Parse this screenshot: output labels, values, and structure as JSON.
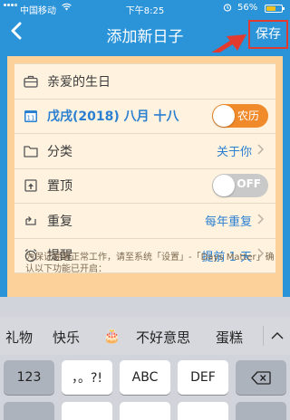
{
  "status_bar": {
    "carrier": "中国移动",
    "time": "下午8:25",
    "battery_pct": "56%",
    "icons": [
      "signal-icon",
      "wifi-icon",
      "alarm-icon",
      "battery-icon"
    ]
  },
  "nav": {
    "back_icon": "chevron-left-icon",
    "title": "添加新日子",
    "save_label": "保存"
  },
  "form": {
    "rows": [
      {
        "icon": "briefcase-icon",
        "label": "亲爱的生日"
      },
      {
        "icon": "calendar-icon",
        "calendar_day": "11",
        "label": "戊戌(2018) 八月 十八",
        "toggle_label": "农历",
        "toggle_on": true
      },
      {
        "icon": "folder-icon",
        "label": "分类",
        "value": "关于你"
      },
      {
        "icon": "pin-top-icon",
        "label": "置顶",
        "toggle_label": "OFF",
        "toggle_on": false
      },
      {
        "icon": "repeat-icon",
        "label": "重复",
        "value": "每年重复"
      },
      {
        "icon": "alarm-clock-icon",
        "label": "提醒",
        "value": "提前 1 天"
      }
    ],
    "note": "为保证提醒正常工作，请至系统「设置」-「Days Matter」确认以下功能已开启："
  },
  "keyboard": {
    "suggestions": [
      "礼物",
      "快乐",
      "🎂",
      "不好意思",
      "蛋糕"
    ],
    "collapse_icon": "chevron-up-icon",
    "keys": [
      "123",
      "，。?!",
      "ABC",
      "DEF"
    ],
    "delete_icon": "backspace-icon"
  },
  "colors": {
    "nav_blue": "#2b93d8",
    "card_bg": "#fcd29a",
    "accent_orange": "#f08a2a",
    "annotation_red": "#e23a2f"
  }
}
